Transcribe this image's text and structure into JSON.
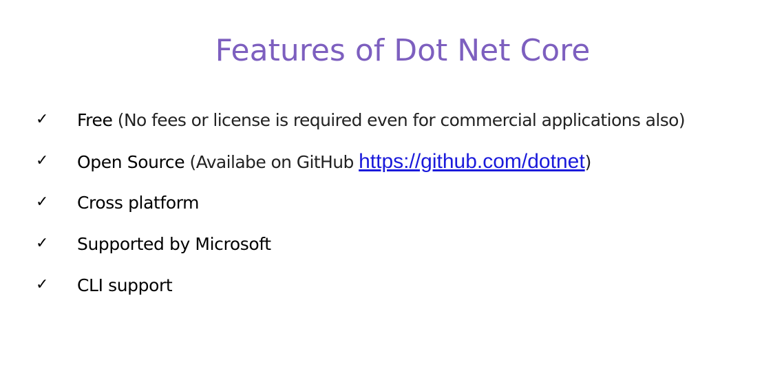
{
  "slide": {
    "title": "Features of Dot Net Core",
    "check_glyph": "✓",
    "items": [
      {
        "label": "Free",
        "detail_open": " (No fees or license is required even for commercial applications also)",
        "link": "",
        "detail_close": ""
      },
      {
        "label": "Open Source",
        "detail_open": " (Availabe on GitHub ",
        "link": "https://github.com/dotnet",
        "detail_close": ")"
      },
      {
        "label": "Cross platform",
        "detail_open": "",
        "link": "",
        "detail_close": ""
      },
      {
        "label": "Supported by Microsoft",
        "detail_open": "",
        "link": "",
        "detail_close": ""
      },
      {
        "label": "CLI support",
        "detail_open": "",
        "link": "",
        "detail_close": ""
      }
    ]
  },
  "colors": {
    "title": "#7d5fbf",
    "link": "#1a1adb",
    "text": "#000000"
  },
  "icons": {
    "bullet": "checkmark-icon"
  }
}
